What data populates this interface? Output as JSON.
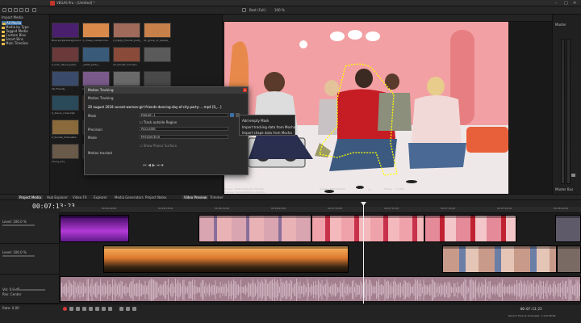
{
  "window": {
    "title": "VEGAS Pro - [Untitled] *"
  },
  "explorer": {
    "header": "Import Media",
    "items": [
      {
        "label": "All Media",
        "selected": true
      },
      {
        "label": "Media by Type"
      },
      {
        "label": "Tagged Media"
      },
      {
        "label": "Custom Bins"
      },
      {
        "label": "Smart Bins"
      },
      {
        "label": "Main Timeline"
      }
    ]
  },
  "media": {
    "captions": [
      "Blue-purple-background-VJ-",
      "2_cheap_sunset-nme-",
      "2_happy_friends_party_",
      "01_group_of_people_",
      "2_man_dance_party-",
      "_skate_party_-",
      "10_Sunset_Convers.",
      "",
      "20_Friends_",
      "18_party_dance.mp4",
      "",
      "",
      "2_dance_crew.mp4",
      "",
      "",
      "",
      "2_Sunset_Silhouette",
      "",
      "",
      "",
      "Young_Girl_",
      "",
      "",
      ""
    ]
  },
  "dialog": {
    "title": "Motion Tracking",
    "subtitle": "Motion Tracking",
    "clipname": "20 august 2018 sunset-woman-girl-friends-dancing-day-of-city-party-...-mp4 [0_...]",
    "mask_label": "Mask",
    "mask_value": "Region 1",
    "track_outside_label": "Track outside Region",
    "precision_label": "Precision",
    "precision_value": "Accurate",
    "mode_label": "Mode",
    "mode_value": "Perspective",
    "show_label": "Show Planar Surface",
    "motion_label": "Motion tracked"
  },
  "context_menu": {
    "items": [
      "Add empty Mask",
      "Import tracking data from Mocha",
      "Import shape data from Mocha"
    ]
  },
  "preview": {
    "zoom": "Best (Full)",
    "zoom_pct": "100 %",
    "project_info": "Project: 1920x1080x32, 29.970p",
    "preview_info": "Preview: 1920x1080x32, 29.970p",
    "display_info": "Display: 550x309x32",
    "frame_label": "Frame:",
    "frame_value": "11,998"
  },
  "master": {
    "label": "Master",
    "sub": "Master Bus"
  },
  "tabs": [
    "Project Media",
    "Hub Explorer",
    "Video FX",
    "Explorer",
    "Media Generators",
    "Project Notes",
    "Video Preview",
    "Trimmer"
  ],
  "timeline": {
    "timecode": "00:07:13;23",
    "ruler": [
      "00:06:00;00",
      "00:06:15;00",
      "00:06:30;00",
      "00:06:45;00",
      "00:07:00;00",
      "00:07:15;00",
      "00:07:30;00",
      "00:07:45;00",
      "00:08:00;00"
    ],
    "tracks": [
      {
        "name": "Level: 100.0 %"
      },
      {
        "name": "Level: 100.0 %"
      },
      {
        "name": "Vol: 0.0 dB",
        "pan": "Pan: Center"
      }
    ]
  },
  "status": {
    "rate": "Rate: 0.00",
    "time": "00:07:13;23",
    "record": "Record Time (2 channels): 1,119:28:49"
  },
  "colors": {
    "accent": "#3a6ea5",
    "audio_clip": "#a37f8e",
    "record": "#d23b3b"
  }
}
